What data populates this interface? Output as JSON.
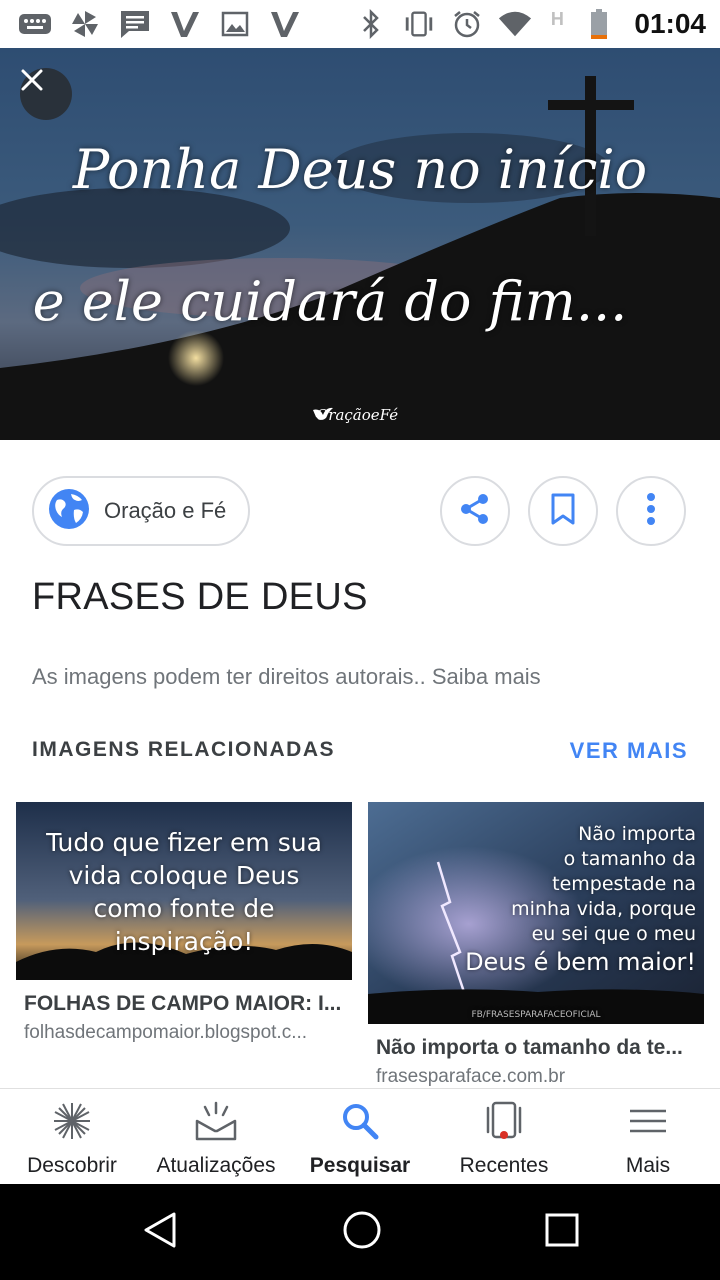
{
  "status_bar": {
    "time": "01:04",
    "left_icons": [
      "keyboard-icon",
      "pinwheel-icon",
      "message-icon",
      "vivo-v-icon",
      "image-icon",
      "vivo-v-icon"
    ],
    "right_icons": [
      "bluetooth-icon",
      "vibrate-icon",
      "alarm-icon",
      "wifi-icon",
      "h-signal-icon",
      "battery-icon"
    ],
    "signal_letter": "H"
  },
  "hero": {
    "line1": "Ponha Deus no início",
    "line2": "e ele cuidará do fim...",
    "watermark": "OraçãoeFé"
  },
  "source": {
    "label": "Oração e Fé"
  },
  "actions": {
    "share": "share-icon",
    "save": "bookmark-icon",
    "more": "more-vert-icon"
  },
  "title": "FRASES DE DEUS",
  "rights_text": "As imagens podem ter direitos autorais.. Saiba mais",
  "related": {
    "heading": "IMAGENS RELACIONADAS",
    "more_label": "VER MAIS",
    "cards": [
      {
        "thumb_text": [
          "Tudo que fizer em sua",
          "vida coloque Deus",
          "como fonte de",
          "inspiração!"
        ],
        "title": "FOLHAS DE CAMPO MAIOR: I...",
        "site": "folhasdecampomaior.blogspot.c..."
      },
      {
        "thumb_text": [
          "Não importa",
          "o tamanho da",
          "tempestade na",
          "minha vida, porque",
          "eu sei que o meu",
          "Deus é bem maior!"
        ],
        "thumb_footer": "FB/FRASESPARAFACEOFICIAL",
        "title": "Não importa o tamanho da te...",
        "site": "frasesparaface.com.br"
      }
    ]
  },
  "bottom_nav": [
    {
      "label": "Descobrir",
      "icon": "asterisk-icon"
    },
    {
      "label": "Atualizações",
      "icon": "updates-icon"
    },
    {
      "label": "Pesquisar",
      "icon": "search-icon"
    },
    {
      "label": "Recentes",
      "icon": "recent-cards-icon"
    },
    {
      "label": "Mais",
      "icon": "menu-icon"
    }
  ],
  "colors": {
    "accent": "#4285f4",
    "badge": "#d93025",
    "chip_border": "#dadce0"
  }
}
